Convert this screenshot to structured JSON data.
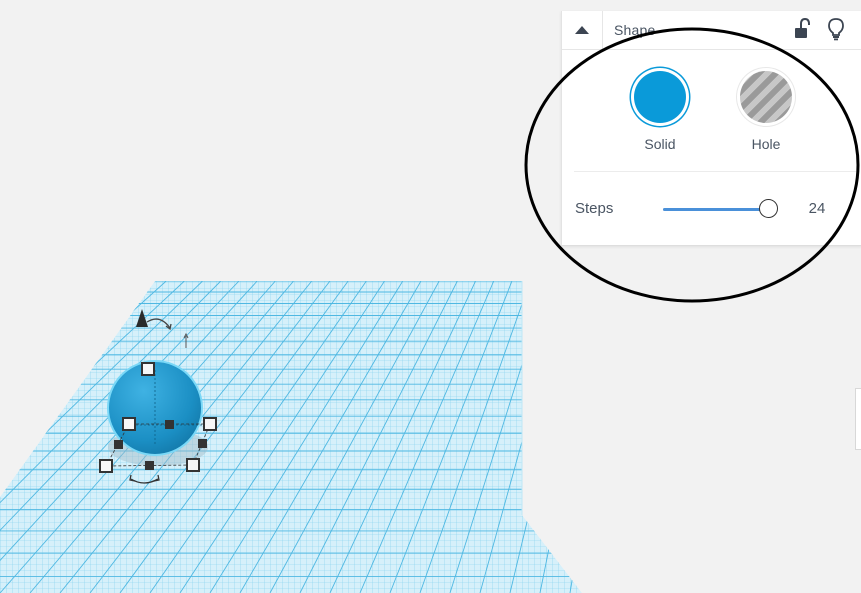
{
  "inspector": {
    "title": "Shape",
    "collapse_icon": "caret-up-icon",
    "lock_icon": "unlocked-padlock-icon",
    "light_icon": "lightbulb-icon",
    "type_options": [
      {
        "label": "Solid",
        "color": "#0a9ad9",
        "selected": true
      },
      {
        "label": "Hole",
        "color": "#9a9a9a",
        "selected": false
      }
    ],
    "steps": {
      "label": "Steps",
      "value": "24",
      "fill_fraction": 1.0
    }
  },
  "workplane": {
    "grid_color": "#6cc6e8",
    "shape": {
      "type": "sphere",
      "color": "#1b8fc4"
    },
    "rotate_icon": "rotate-arrow-icon",
    "cone_icon": "lift-cone-icon"
  },
  "annotation": {
    "color": "#000000"
  }
}
